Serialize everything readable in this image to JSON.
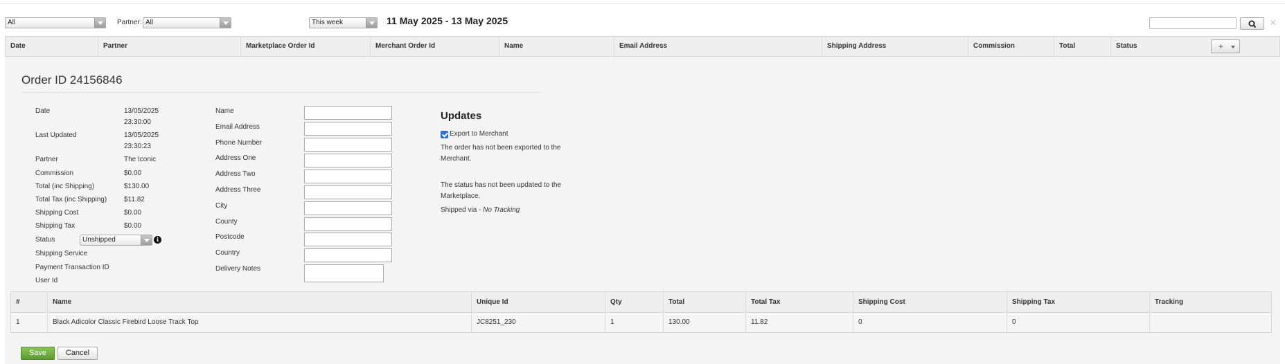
{
  "filters": {
    "filter1_value": "All",
    "partner_label": "Partner:",
    "partner_value": "All",
    "period_value": "This week",
    "date_range": "11 May 2025 - 13 May 2025"
  },
  "search": {
    "value": ""
  },
  "columns": [
    "Date",
    "Partner",
    "Marketplace Order Id",
    "Merchant Order Id",
    "Name",
    "Email Address",
    "Shipping Address",
    "Commission",
    "Total",
    "Status"
  ],
  "column_picker_label": "+",
  "order": {
    "title": "Order ID 24156846",
    "details": [
      {
        "label": "Date",
        "value": "13/05/2025",
        "value2": "23:30:00"
      },
      {
        "label": "Last Updated",
        "value": "13/05/2025",
        "value2": "23:30:23"
      },
      {
        "label": "Partner",
        "value": "The Iconic"
      },
      {
        "label": "Commission",
        "value": "$0.00"
      },
      {
        "label": "Total (inc Shipping)",
        "value": "$130.00"
      },
      {
        "label": "Total Tax (inc Shipping)",
        "value": "$11.82"
      },
      {
        "label": "Shipping Cost",
        "value": "$0.00"
      },
      {
        "label": "Shipping Tax",
        "value": "$0.00"
      },
      {
        "label": "Status",
        "value": "Unshipped"
      },
      {
        "label": "Shipping Service",
        "value": ""
      },
      {
        "label": "Payment Transaction ID",
        "value": ""
      },
      {
        "label": "User Id",
        "value": ""
      }
    ],
    "address_fields": [
      {
        "label": "Name",
        "value": ""
      },
      {
        "label": "Email Address",
        "value": ""
      },
      {
        "label": "Phone Number",
        "value": ""
      },
      {
        "label": "Address One",
        "value": ""
      },
      {
        "label": "Address Two",
        "value": ""
      },
      {
        "label": "Address Three",
        "value": ""
      },
      {
        "label": "City",
        "value": ""
      },
      {
        "label": "County",
        "value": ""
      },
      {
        "label": "Postcode",
        "value": ""
      },
      {
        "label": "Country",
        "value": ""
      },
      {
        "label": "Delivery Notes",
        "value": ""
      }
    ]
  },
  "updates": {
    "title": "Updates",
    "export_label": "Export to Merchant",
    "export_checked": true,
    "export_status": "The order has not been exported to the Merchant.",
    "status_update": "The status has not been updated to the Marketplace.",
    "shipped_prefix": "Shipped via - ",
    "shipped_value": "No Tracking"
  },
  "items": {
    "headers": [
      "#",
      "Name",
      "Unique Id",
      "Qty",
      "Total",
      "Total Tax",
      "Shipping Cost",
      "Shipping Tax",
      "Tracking"
    ],
    "rows": [
      [
        "1",
        "Black Adicolor Classic Firebird Loose Track Top",
        "JC8251_230",
        "1",
        "130.00",
        "11.82",
        "0",
        "0",
        ""
      ]
    ]
  },
  "actions": {
    "save": "Save",
    "cancel": "Cancel"
  },
  "colors": {
    "accent_save": "#6aab3c",
    "checkbox": "#2a6fd6"
  }
}
